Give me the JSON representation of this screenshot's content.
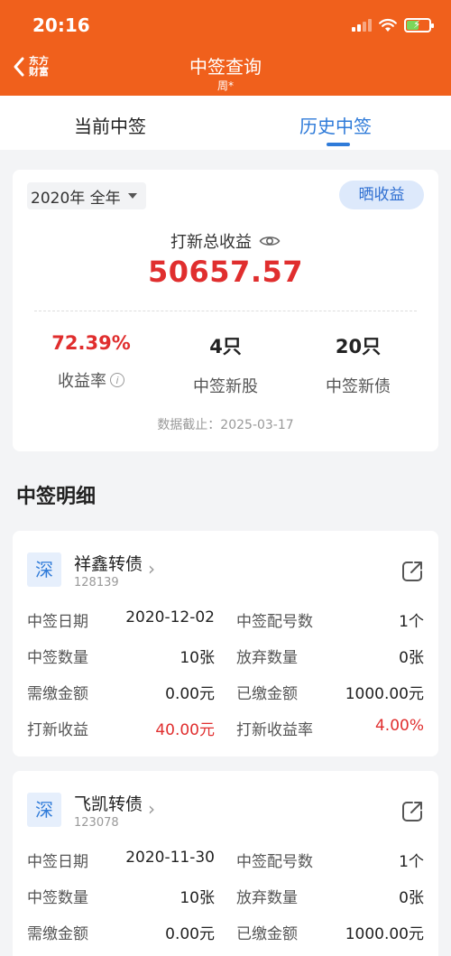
{
  "status_bar": {
    "time": "20:16"
  },
  "nav": {
    "logo_text": "东方财富",
    "title": "中签查询",
    "subtitle": "周*"
  },
  "tabs": [
    {
      "label": "当前中签",
      "active": false
    },
    {
      "label": "历史中签",
      "active": true
    }
  ],
  "summary": {
    "year_select": "2020年 全年",
    "share_button": "晒收益",
    "total_label": "打新总收益",
    "total_value": "50657.57",
    "stats": [
      {
        "value": "72.39%",
        "label": "收益率"
      },
      {
        "value": "4只",
        "label": "中签新股"
      },
      {
        "value": "20只",
        "label": "中签新债"
      }
    ],
    "as_of": "数据截止：2025-03-17"
  },
  "section_title": "中签明细",
  "records": [
    {
      "market": "深",
      "name": "祥鑫转债",
      "code": "128139",
      "rows": [
        [
          "中签日期",
          "2020-12-02",
          "中签配号数",
          "1个"
        ],
        [
          "中签数量",
          "10张",
          "放弃数量",
          "0张"
        ],
        [
          "需缴金额",
          "0.00元",
          "已缴金额",
          "1000.00元"
        ],
        [
          "打新收益",
          "40.00元",
          "打新收益率",
          "4.00%"
        ]
      ]
    },
    {
      "market": "深",
      "name": "飞凯转债",
      "code": "123078",
      "rows": [
        [
          "中签日期",
          "2020-11-30",
          "中签配号数",
          "1个"
        ],
        [
          "中签数量",
          "10张",
          "放弃数量",
          "0张"
        ],
        [
          "需缴金额",
          "0.00元",
          "已缴金额",
          "1000.00元"
        ]
      ]
    }
  ],
  "colors": {
    "header": "#f0601c",
    "accent_blue": "#2f7bd9",
    "profit_red": "#e02e2e"
  }
}
